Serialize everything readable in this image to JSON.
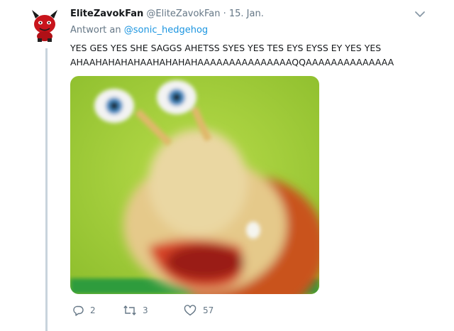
{
  "tweet": {
    "author_name": "EliteZavokFan",
    "author_handle": "@EliteZavokFan",
    "separator": "·",
    "date": "15. Jan.",
    "reply_prefix": "Antwort an",
    "reply_mention": "@sonic_hedgehog",
    "text_lines": [
      "YES GES YES SHE SAGGS AHETSS SYES YES TES EYS EYSS EY YES YES",
      "AHAAHAHAHAHAAHAHAHAHAAAAAAAAAAAAAAAQQAAAAAAAAAAAAAA"
    ],
    "media_icon": "blurry-cartoon-creature-photo"
  },
  "actions": {
    "reply_count": "2",
    "retweet_count": "3",
    "like_count": "57",
    "reply_icon": "reply-bubble-icon",
    "retweet_icon": "retweet-icon",
    "like_icon": "heart-icon"
  },
  "colors": {
    "link": "#1b95e0",
    "muted": "#657786",
    "thread_line": "#c8d3dc",
    "media_background": "#9ccb33"
  }
}
